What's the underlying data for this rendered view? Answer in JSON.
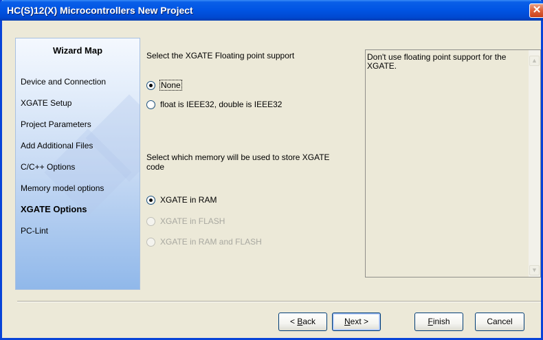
{
  "window": {
    "title": "HC(S)12(X) Microcontrollers New Project",
    "close_glyph": "✕"
  },
  "wizard_map": {
    "title": "Wizard Map",
    "items": [
      {
        "label": "Device and Connection",
        "active": false
      },
      {
        "label": "XGATE Setup",
        "active": false
      },
      {
        "label": "Project Parameters",
        "active": false
      },
      {
        "label": "Add Additional Files",
        "active": false
      },
      {
        "label": "C/C++ Options",
        "active": false
      },
      {
        "label": "Memory model options",
        "active": false
      },
      {
        "label": "XGATE Options",
        "active": true
      },
      {
        "label": "PC-Lint",
        "active": false
      }
    ]
  },
  "floating_point": {
    "prompt": "Select the XGATE Floating point support",
    "options": [
      {
        "label": "None",
        "checked": true,
        "disabled": false
      },
      {
        "label": "float is IEEE32, double is IEEE32",
        "checked": false,
        "disabled": false
      }
    ]
  },
  "memory": {
    "prompt_line1": "Select which memory will be used to store XGATE",
    "prompt_line2": "code",
    "options": [
      {
        "label": "XGATE in RAM",
        "checked": true,
        "disabled": false
      },
      {
        "label": "XGATE in FLASH",
        "checked": false,
        "disabled": true
      },
      {
        "label": "XGATE in RAM and FLASH",
        "checked": false,
        "disabled": true
      }
    ]
  },
  "description": {
    "text": "Don't use floating point support for the XGATE.",
    "scroll_up_icon": "▲",
    "scroll_down_icon": "▼"
  },
  "buttons": {
    "back": {
      "mnemonic": "B",
      "rest": "ack",
      "prefix": "< "
    },
    "next": {
      "mnemonic": "N",
      "rest": "ext >"
    },
    "finish": {
      "mnemonic": "F",
      "rest": "inish"
    },
    "cancel": {
      "label": "Cancel"
    }
  }
}
